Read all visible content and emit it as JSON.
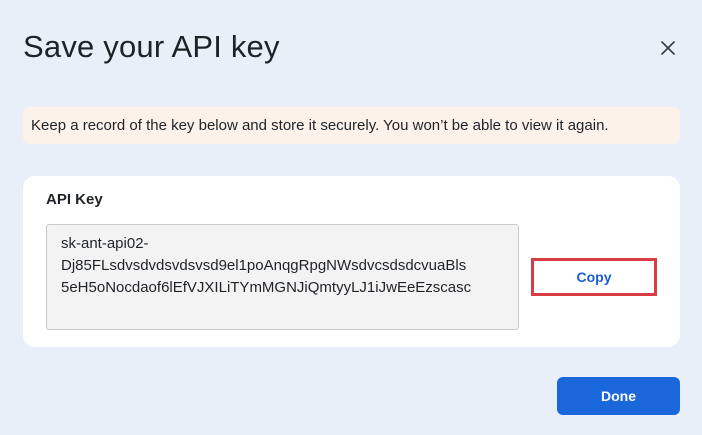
{
  "dialog": {
    "title": "Save your API key",
    "close_icon": "close-icon"
  },
  "warning": {
    "text": "Keep a record of the key below and store it securely. You won’t be able to view it again."
  },
  "key_card": {
    "label": "API Key",
    "key_lines": [
      "sk-ant-api02-",
      "Dj85FLsdvsdvdsvdsvsd9el1poAnqgRpgNWsdvcsdsdcvuaBls",
      "5eH5oNocdaof6lEfVJXILiTYmMGNJiQmtyyLJ1iJwEeEzscasc"
    ],
    "copy_label": "Copy"
  },
  "footer": {
    "done_label": "Done"
  },
  "colors": {
    "background": "#e9eff8",
    "warning_bg": "#fcf2ea",
    "primary": "#1a67dc",
    "copy_highlight": "#d93d44"
  }
}
